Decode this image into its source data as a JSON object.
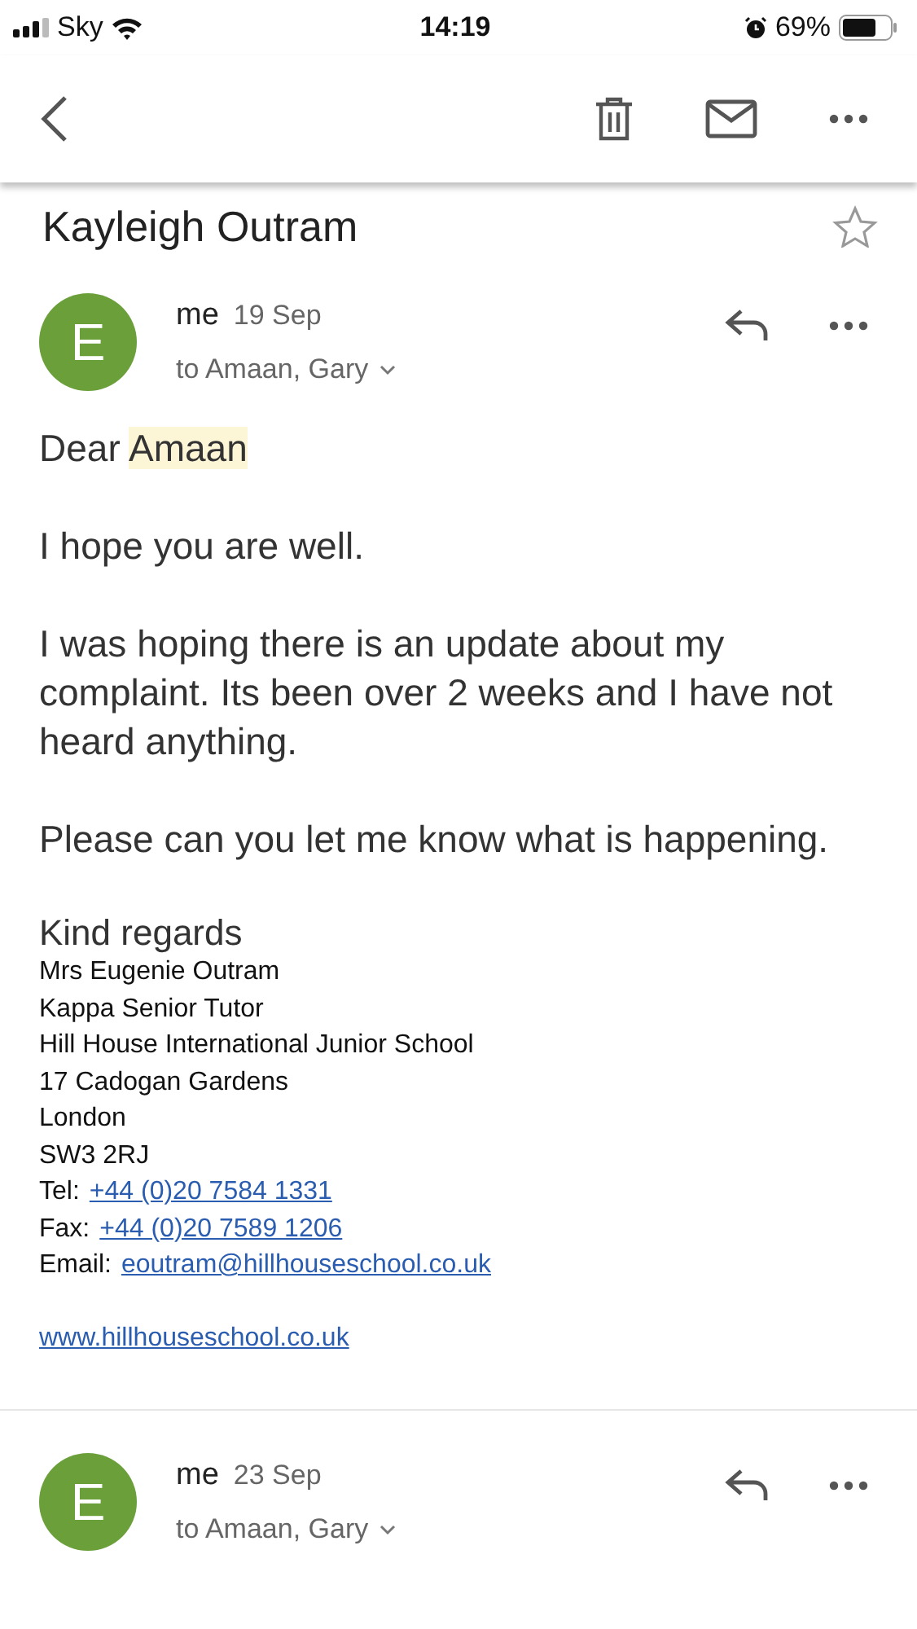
{
  "status_bar": {
    "carrier": "Sky",
    "time": "14:19",
    "battery": "69%"
  },
  "subject": {
    "text": "Kayleigh Outram",
    "starred": false
  },
  "messages": [
    {
      "avatar": "E",
      "sender": "me",
      "date": "19 Sep",
      "recipients": "to Amaan, Gary",
      "expanded": true,
      "greeting": {
        "text": "Dear",
        "highlight": "Amaan"
      },
      "paragraphs": [
        "I hope you are well.",
        "I was hoping there is an update about my complaint. Its been over 2 weeks and I have not heard anything.",
        "Please can you let me know what is happening."
      ],
      "closing": "Kind regards",
      "signature": [
        {
          "kind": "text",
          "text": "Mrs Eugenie Outram"
        },
        {
          "kind": "text",
          "text": "Kappa Senior Tutor"
        },
        {
          "kind": "text",
          "text": "Hill House International Junior School"
        },
        {
          "kind": "text",
          "text": "17 Cadogan Gardens"
        },
        {
          "kind": "text",
          "text": "London"
        },
        {
          "kind": "text",
          "text": "SW3 2RJ"
        },
        {
          "kind": "link",
          "label": "Tel:",
          "link": "+44 (0)20 7584 1331"
        },
        {
          "kind": "link",
          "label": "Fax:",
          "link": "+44 (0)20 7589 1206"
        },
        {
          "kind": "link",
          "label": "Email:",
          "link": "eoutram@hillhouseschool.co.uk"
        },
        {
          "kind": "gap"
        },
        {
          "kind": "link",
          "link": "www.hillhouseschool.co.uk"
        }
      ]
    },
    {
      "avatar": "E",
      "sender": "me",
      "date": "23 Sep",
      "recipients": "to Amaan, Gary",
      "expanded": false
    }
  ]
}
